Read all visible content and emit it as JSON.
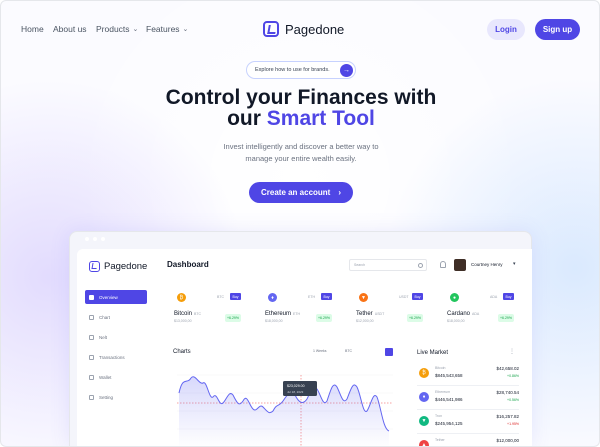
{
  "nav": {
    "links": [
      "Home",
      "About us",
      "Products",
      "Features"
    ],
    "brand": "Pagedone",
    "login": "Login",
    "signup": "Sign up"
  },
  "hero": {
    "pill": "Explore how to use for brands.",
    "headline_line1": "Control your Finances with",
    "headline_line2_prefix": "our ",
    "headline_accent": "Smart Tool",
    "subtext_line1": "Invest intelligently and discover a better way to",
    "subtext_line2": "manage your entire wealth easily.",
    "cta": "Create an account"
  },
  "dashboard": {
    "brand": "Pagedone",
    "title": "Dashboard",
    "search_placeholder": "Search",
    "user": "Courtney Henry",
    "sidebar": [
      {
        "label": "Overview",
        "active": true
      },
      {
        "label": "Chart",
        "active": false
      },
      {
        "label": "Nelt",
        "active": false
      },
      {
        "label": "Transactions",
        "active": false
      },
      {
        "label": "Wallet",
        "active": false
      },
      {
        "label": "Setting",
        "active": false
      }
    ],
    "coins": [
      {
        "name": "Bitcoin",
        "symbol": "BTC",
        "price": "$13,000,00",
        "change": "+6.29%",
        "color": "#f59e0b",
        "glyph": "₿"
      },
      {
        "name": "Ethereum",
        "symbol": "ETH",
        "price": "$18,000,00",
        "change": "+6.29%",
        "color": "#6366f1",
        "glyph": "♦"
      },
      {
        "name": "Tether",
        "symbol": "USDT",
        "price": "$12,000,00",
        "change": "+6.29%",
        "color": "#f97316",
        "glyph": "▼"
      },
      {
        "name": "Cardano",
        "symbol": "ADA",
        "price": "$18,000,00",
        "change": "+6.29%",
        "color": "#22c55e",
        "glyph": "●"
      }
    ],
    "coin_buy": "Buy",
    "chart": {
      "title": "Charts",
      "range": "1 Weeks",
      "currency": "BTC",
      "tooltip_value": "$23,029.00",
      "tooltip_date": "Jul 18, 2023"
    },
    "market": {
      "title": "Live Market",
      "rows": [
        {
          "name": "Bitcoin",
          "price": "$845,543,658",
          "value": "$42,658.02",
          "change": "+0.86%",
          "up": true,
          "color": "#f59e0b",
          "glyph": "₿"
        },
        {
          "name": "Ethereum",
          "price": "$446,541,986",
          "value": "$28,740.54",
          "change": "+0.56%",
          "up": true,
          "color": "#6366f1",
          "glyph": "♦"
        },
        {
          "name": "Tron",
          "price": "$245,954,125",
          "value": "$16,257.82",
          "change": "+1.95%",
          "up": false,
          "color": "#10b981",
          "glyph": "▼"
        },
        {
          "name": "Tether",
          "price": "",
          "value": "$12,000,00",
          "change": "",
          "up": true,
          "color": "#ef4444",
          "glyph": "▲"
        }
      ]
    }
  },
  "colors": {
    "accent": "#4f46e5",
    "positive": "#16a34a",
    "negative": "#dc2626"
  }
}
